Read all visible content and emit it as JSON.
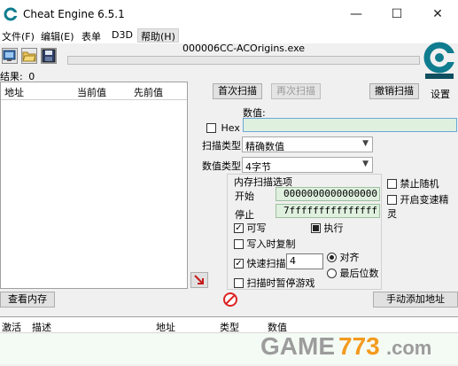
{
  "window": {
    "title": "Cheat Engine 6.5.1",
    "minimize_glyph": "—",
    "maximize_glyph": "☐",
    "close_glyph": "✕"
  },
  "menu": {
    "items": [
      "文件(F)",
      "编辑(E)",
      "表单",
      "D3D",
      "帮助(H)"
    ]
  },
  "toolbar": {
    "icons": [
      "open-process-icon",
      "open-file-icon",
      "save-icon"
    ]
  },
  "process": {
    "name": "000006CC-ACOrigins.exe",
    "progress": 0
  },
  "found": {
    "label": "结果:",
    "count": "0"
  },
  "address_list": {
    "columns": [
      "地址",
      "当前值",
      "先前值"
    ]
  },
  "scan": {
    "first_scan": "首次扫描",
    "next_scan": "再次扫描",
    "undo_scan": "撤销扫描",
    "settings": "设置",
    "value_label": "数值:",
    "hex_label": "Hex",
    "value": "",
    "scan_type_label": "扫描类型",
    "scan_type_value": "精确数值",
    "value_type_label": "数值类型",
    "value_type_value": "4字节"
  },
  "memory_options": {
    "title": "内存扫描选项",
    "start_label": "开始",
    "start_value": "0000000000000000",
    "stop_label": "停止",
    "stop_value": "7fffffffffffffff",
    "writable_label": "可写",
    "executable_label": "执行",
    "copy_on_write_label": "写入时复制",
    "fast_scan_label": "快速扫描",
    "fast_scan_value": "4",
    "align_label": "对齐",
    "last_digits_label": "最后位数",
    "pause_game_label": "扫描时暂停游戏"
  },
  "extra_options": {
    "disable_random": "禁止随机",
    "speedhack": "开启变速精灵"
  },
  "bottom": {
    "memory_view": "查看内存",
    "add_address": "手动添加地址",
    "columns": [
      "激活",
      "描述",
      "地址",
      "类型",
      "数值"
    ]
  },
  "watermark": {
    "text_a": "GAME",
    "text_b": "773",
    "text_c": ".com"
  },
  "colors": {
    "input_green": "#dff0df",
    "watermark_gray": "#9c9c9c",
    "watermark_orange": "#f39a1e",
    "logo_teal": "#0f7c8f"
  }
}
